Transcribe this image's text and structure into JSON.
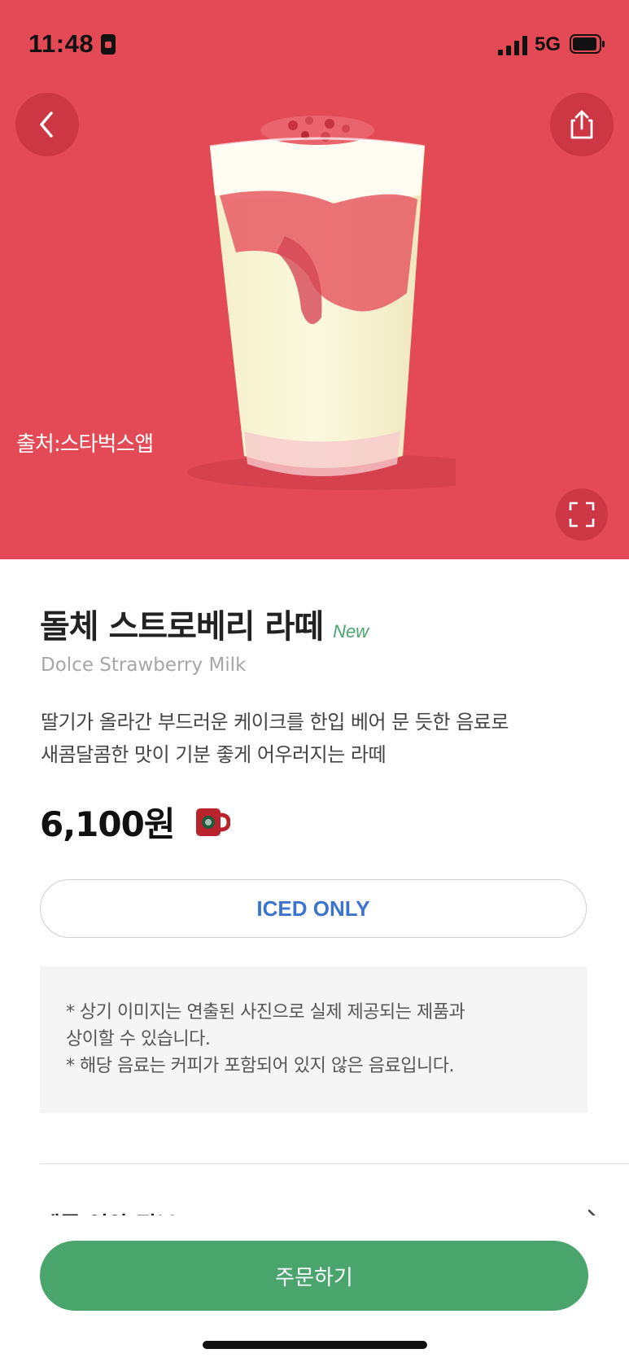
{
  "status_bar": {
    "time": "11:48",
    "network": "5G"
  },
  "hero": {
    "background": "#e34a55",
    "watermark": "출처:스타벅스앱"
  },
  "product": {
    "name_ko": "돌체 스트로베리 라떼",
    "new_badge": "New",
    "name_en": "Dolce Strawberry Milk",
    "description_line1": "딸기가 올라간 부드러운 케이크를 한입 베어 문 듯한 음료로",
    "description_line2": "새콤달콤한 맛이 기분 좋게 어우러지는 라떼",
    "price": "6,100원"
  },
  "temperature_option": "ICED ONLY",
  "notice": {
    "line1": "* 상기 이미지는 연출된 사진으로 실제 제공되는 제품과",
    "line2": "상이할 수 있습니다.",
    "line3": "* 해당 음료는 커피가 포함되어 있지 않은 음료입니다."
  },
  "nutrition_label": "제품 영양 정보",
  "order_button": "주문하기",
  "colors": {
    "accent_green": "#4aa56d",
    "accent_blue": "#3b74cf",
    "new_tag": "#4aa56d"
  },
  "icons": [
    "signal-icon",
    "battery-icon",
    "back-chevron-icon",
    "share-icon",
    "fullscreen-icon",
    "mug-icon",
    "chevron-right-icon"
  ]
}
